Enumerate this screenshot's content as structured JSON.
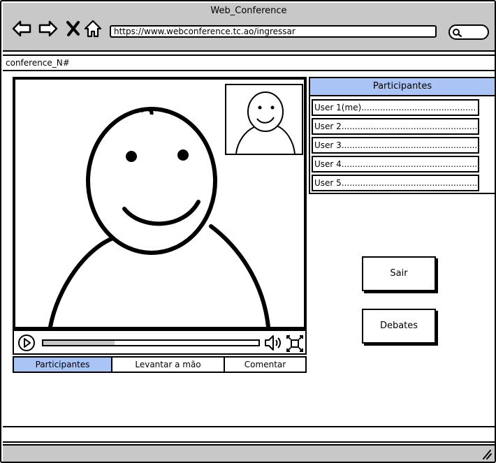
{
  "window": {
    "title": "Web_Conference",
    "url": "https://www.webconference.tc.ao/ingressar"
  },
  "toolbar": {
    "back_icon": "arrow-left-icon",
    "forward_icon": "arrow-right-icon",
    "close_icon": "x-icon",
    "home_icon": "home-icon",
    "search_icon": "magnifier-icon"
  },
  "tab": {
    "label": "conference_N#"
  },
  "player": {
    "progress_fraction": 0.33,
    "play_icon": "play-icon",
    "volume_icon": "speaker-icon",
    "fullscreen_icon": "fullscreen-icon"
  },
  "action_tabs": [
    {
      "label": "Participantes",
      "active": true
    },
    {
      "label": "Levantar a mão",
      "active": false
    },
    {
      "label": "Comentar",
      "active": false
    }
  ],
  "participants": {
    "header": "Participantes",
    "users": [
      "User 1(me)...........................................",
      "User 2...........................................................",
      "User 3...........................................................",
      "User 4...........................................................",
      "User 5..........................................................."
    ]
  },
  "buttons": {
    "sair": "Sair",
    "debates": "Debates"
  },
  "colors": {
    "chrome_gray": "#c8c8c8",
    "accent_blue": "#a9c4f5"
  }
}
